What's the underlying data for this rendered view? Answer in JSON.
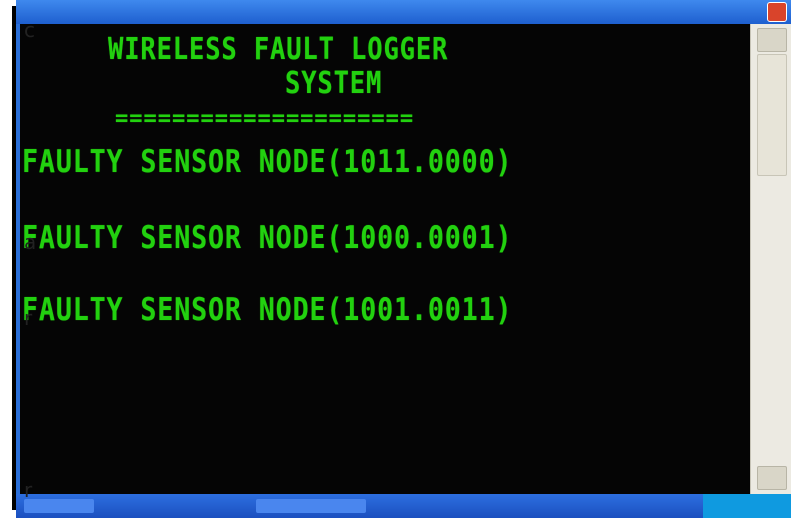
{
  "console": {
    "title_line_1": "WIRELESS FAULT LOGGER",
    "title_line_2": "SYSTEM",
    "separator": "=====================",
    "faults": [
      "FAULTY SENSOR NODE(1011.0000)",
      "FAULTY SENSOR NODE(1000.0001)",
      "FAULTY SENSOR NODE(1001.0011)"
    ]
  },
  "margin_glyphs": [
    "c",
    "a",
    "r",
    "r"
  ],
  "colors": {
    "console_bg": "#050505",
    "console_text": "#22d10f",
    "window_frame": "#2a6fd9",
    "scrollbar": "#eceae2"
  }
}
